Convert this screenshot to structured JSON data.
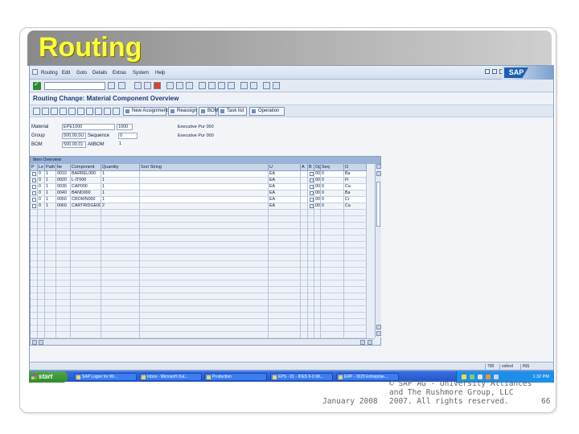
{
  "slide": {
    "title": "Routing",
    "footer_date": "January 2008",
    "footer_copyright": [
      "© SAP AG - University Alliances",
      "and The Rushmore Group, LLC",
      "2007. All rights reserved."
    ],
    "page_number": "66",
    "title_color": "#ffff33"
  },
  "sap": {
    "menu": [
      "Routing",
      "Edit",
      "Goto",
      "Details",
      "Extras",
      "System",
      "Help"
    ],
    "screen_title": "Routing Change: Material Component Overview",
    "app_buttons": [
      "New Assignment",
      "Reassign",
      "BOM",
      "Task list",
      "Operation"
    ],
    "header": {
      "material_label": "Material",
      "material_value": "EPE1000",
      "plant_value": "1000",
      "material_desc": "Executive Pur 000",
      "group_label": "Group",
      "group_value": "500,00,0U",
      "sequence_label": "Sequence",
      "sequence_value": "0",
      "group_desc": "Executive Pur 000",
      "bom_label": "BOM",
      "bom_value": "500,00,01",
      "altbom_label": "AltBOM",
      "altbom_value": "1"
    },
    "grid": {
      "caption": "Item Overview",
      "columns": [
        "P",
        "Le",
        "Path",
        "Ite",
        "Component",
        "Quantity",
        "Sort String",
        "U",
        "A",
        "B",
        "Oper",
        "Seq",
        "O"
      ],
      "rows": [
        [
          "0",
          "1",
          "0010",
          "BARREL000",
          "1",
          "EA",
          "0030",
          "0"
        ],
        [
          "0",
          "1",
          "0020",
          "L-IT000",
          "1",
          "EA",
          "0010",
          "0"
        ],
        [
          "0",
          "1",
          "0030",
          "CAP000",
          "1",
          "EA",
          "0010",
          "0"
        ],
        [
          "0",
          "1",
          "0040",
          "BAND000",
          "1",
          "EA",
          "0030",
          "0"
        ],
        [
          "0",
          "1",
          "0050",
          "CROWN000",
          "1",
          "EA",
          "0030",
          "0"
        ],
        [
          "0",
          "1",
          "0060",
          "CARTRIDGE000",
          "2",
          "EA",
          "0010",
          "0"
        ]
      ],
      "row_suffix": [
        "Ba",
        "Fl",
        "Ca",
        "Ba",
        "Cr",
        "Ca"
      ]
    },
    "status": [
      "700",
      "oxford",
      "INS"
    ],
    "taskbar": {
      "start": "start",
      "tasks": [
        "SAP Logon for Wi...",
        "Inbox - Microsoft Out...",
        "Production",
        "EPS - 01 - IDES 6-0 IM...",
        "ERP - 1620 Entreprise..."
      ],
      "clock": "1:32 PM"
    }
  }
}
